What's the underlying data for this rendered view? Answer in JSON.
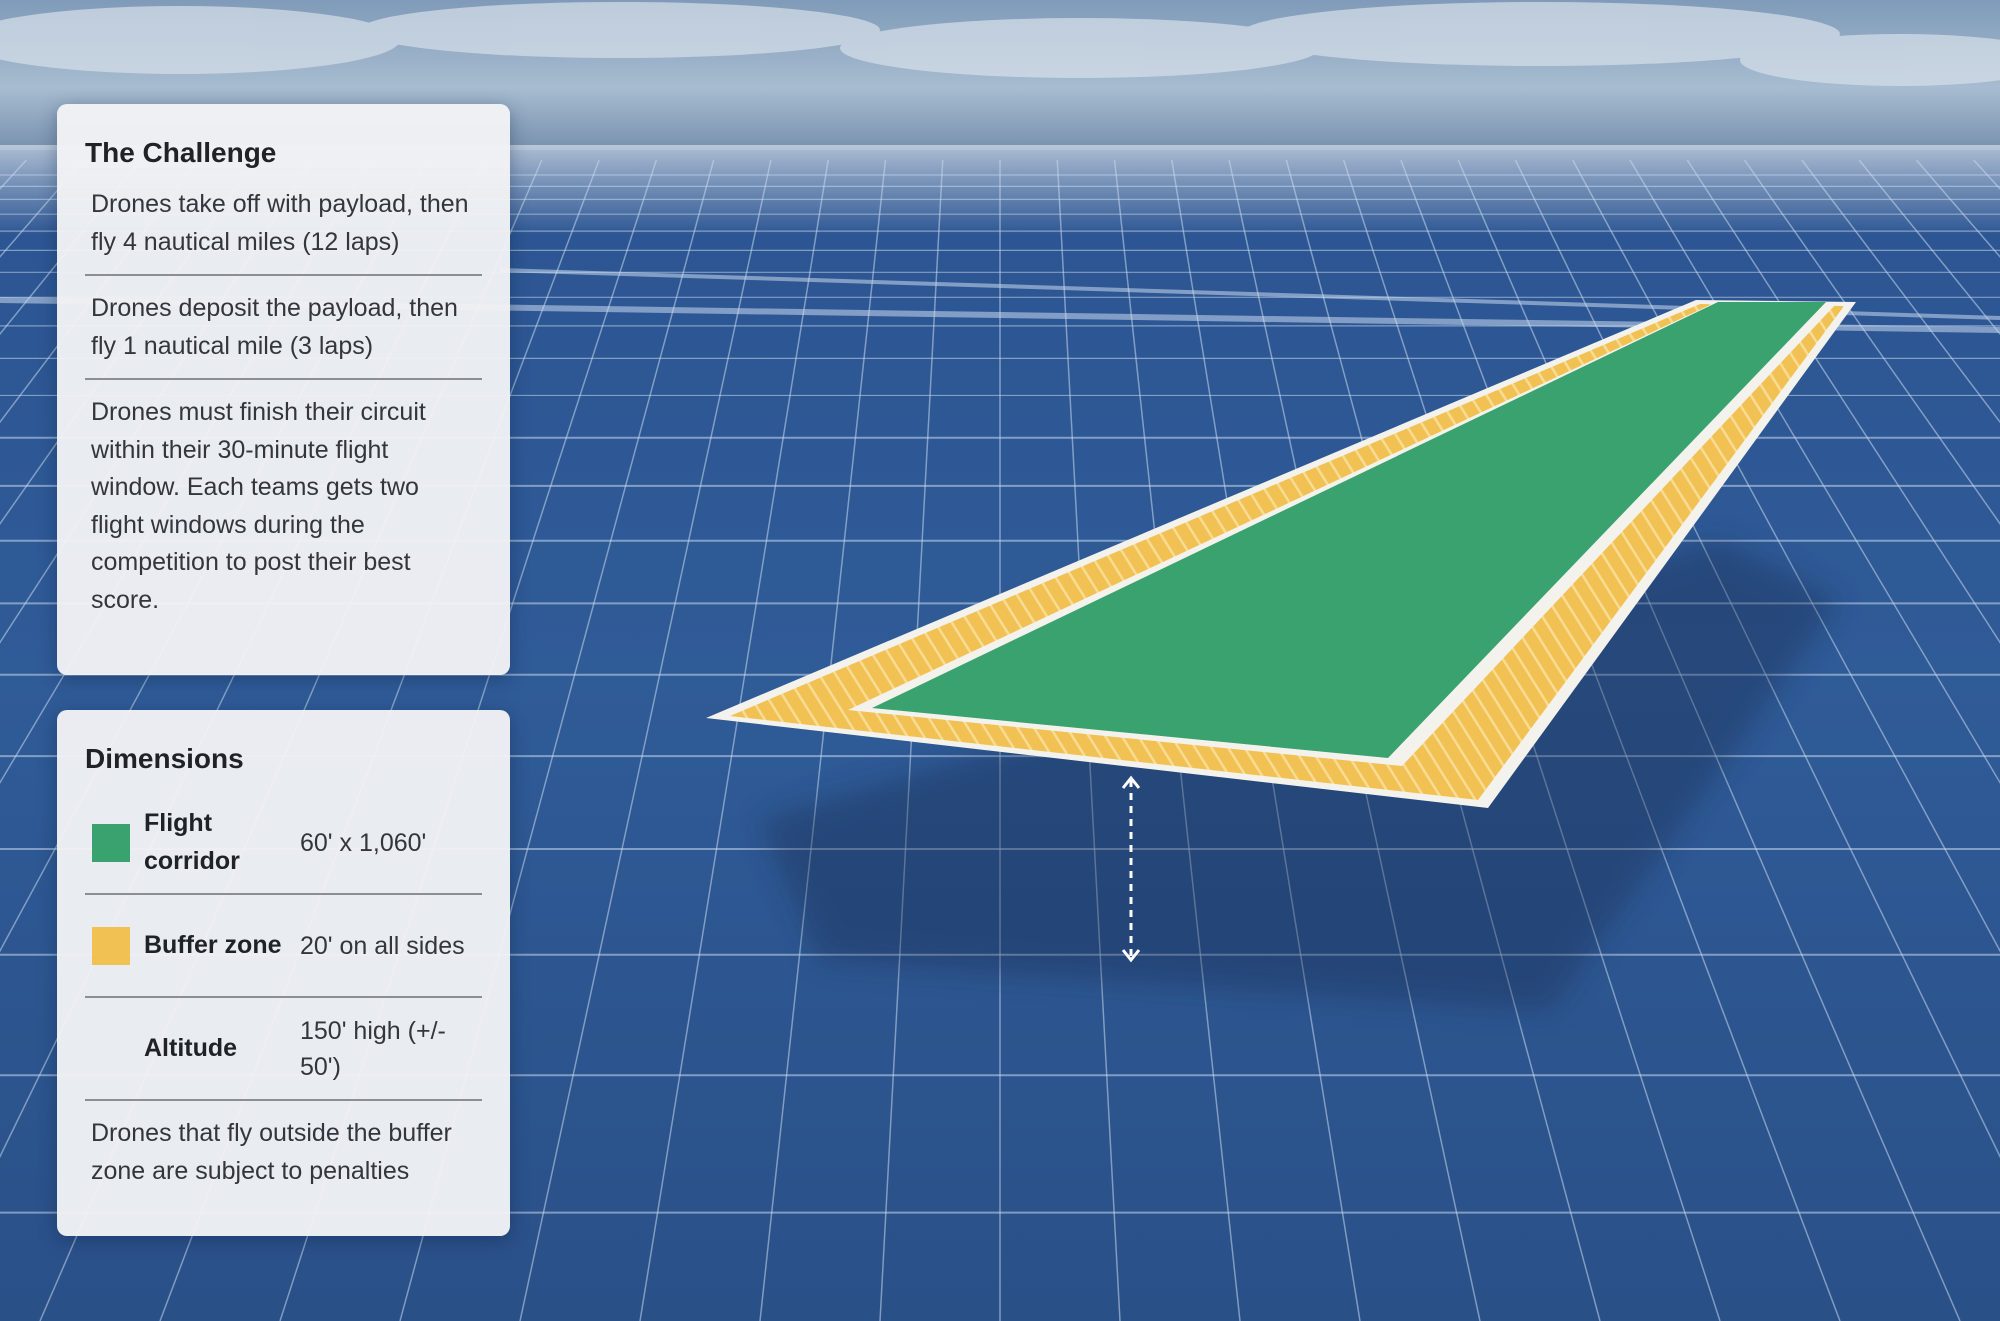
{
  "challenge": {
    "title": "The Challenge",
    "items": [
      "Drones take off with payload, then fly 4 nautical miles (12 laps)",
      "Drones deposit the payload, then fly 1 nautical mile (3 laps)",
      "Drones must finish their circuit within their 30-minute flight window. Each teams gets two flight windows during the competition to post their best score."
    ]
  },
  "dimensions": {
    "title": "Dimensions",
    "rows": [
      {
        "label": "Flight corridor",
        "value": "60' x 1,060'",
        "swatch_color": "#3aa26e"
      },
      {
        "label": "Buffer zone",
        "value": "20' on all sides",
        "swatch_color": "#f1c153"
      },
      {
        "label": "Altitude",
        "value": "150' high (+/- 50')",
        "swatch_color": ""
      }
    ],
    "note": "Drones that fly outside the buffer zone are subject to penalties"
  },
  "colors": {
    "flight_corridor": "#3aa26e",
    "buffer_zone": "#f1c153",
    "border": "#f4f2ec",
    "grid_background": "#2e5a92",
    "grid_lines": "#c9d8ee"
  },
  "icons": [
    "altitude-arrow-icon"
  ]
}
